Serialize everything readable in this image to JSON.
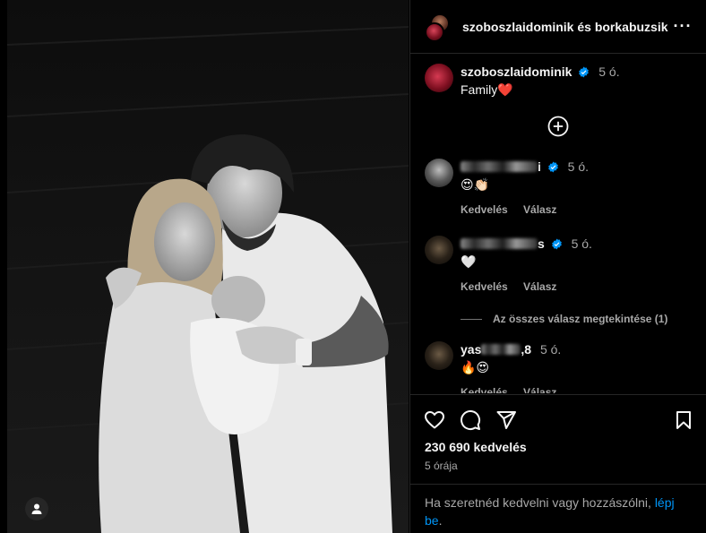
{
  "header": {
    "title": "szoboszlaidominik és borkabuzsik"
  },
  "caption": {
    "username": "szoboszlaidominik",
    "time": "5 ó.",
    "text": "Family"
  },
  "comments": [
    {
      "username": "",
      "username_suffix": "i",
      "time": "5 ó.",
      "text": "😍👏🏻",
      "actions": {
        "like": "Kedvelés",
        "reply": "Válasz"
      }
    },
    {
      "username": "",
      "username_suffix": "s",
      "time": "5 ó.",
      "text": "🤍",
      "actions": {
        "like": "Kedvelés",
        "reply": "Válasz"
      },
      "view_replies": "Az összes válasz megtekintése (1)"
    },
    {
      "username": "yas",
      "username_suffix": ",8",
      "time": "5 ó.",
      "text": "🔥😍",
      "actions": {
        "like": "Kedvelés",
        "reply": "Válasz"
      }
    }
  ],
  "stats": {
    "likes": "230 690 kedvelés",
    "ago": "5 órája"
  },
  "login_prompt": {
    "text": "Ha szeretnéd kedvelni vagy hozzászólni, ",
    "link": "lépj be",
    "end": "."
  },
  "colors": {
    "background": "#000000",
    "link": "#0095f6",
    "verified": "#0095f6",
    "secondary_text": "#a8a8a8"
  }
}
